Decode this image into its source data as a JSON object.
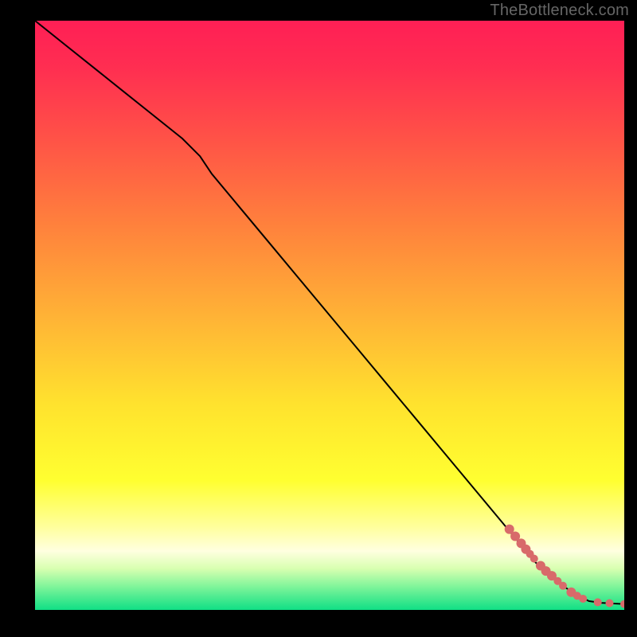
{
  "watermark": "TheBottleneck.com",
  "colors": {
    "background": "#000000",
    "line": "#000000",
    "dot": "#d86a6a",
    "watermark": "#666666"
  },
  "chart_data": {
    "type": "line",
    "title": "",
    "xlabel": "",
    "ylabel": "",
    "xlim": [
      0,
      100
    ],
    "ylim": [
      0,
      100
    ],
    "background_gradient": [
      {
        "offset": 0.0,
        "color": "#ff1f55"
      },
      {
        "offset": 0.08,
        "color": "#ff2e51"
      },
      {
        "offset": 0.2,
        "color": "#ff5247"
      },
      {
        "offset": 0.35,
        "color": "#ff823c"
      },
      {
        "offset": 0.5,
        "color": "#ffb236"
      },
      {
        "offset": 0.65,
        "color": "#ffe22e"
      },
      {
        "offset": 0.78,
        "color": "#ffff30"
      },
      {
        "offset": 0.86,
        "color": "#ffff9e"
      },
      {
        "offset": 0.9,
        "color": "#ffffe0"
      },
      {
        "offset": 0.93,
        "color": "#d8ffb0"
      },
      {
        "offset": 0.96,
        "color": "#80f59a"
      },
      {
        "offset": 1.0,
        "color": "#10df85"
      }
    ],
    "series": [
      {
        "name": "curve",
        "x": [
          0,
          5,
          10,
          15,
          20,
          25,
          28,
          30,
          35,
          40,
          45,
          50,
          55,
          60,
          65,
          70,
          75,
          80,
          85,
          88,
          90,
          92,
          94,
          96,
          98,
          100
        ],
        "y": [
          100,
          96,
          92,
          88,
          84,
          80,
          77,
          74,
          68,
          62,
          56,
          50,
          44,
          38,
          32,
          26,
          20,
          14,
          8,
          5.5,
          3.8,
          2.5,
          1.5,
          1.2,
          1.1,
          1.0
        ]
      }
    ],
    "dots": {
      "name": "markers",
      "points": [
        {
          "x": 80.5,
          "y": 13.7,
          "r": 6
        },
        {
          "x": 81.5,
          "y": 12.5,
          "r": 6
        },
        {
          "x": 82.5,
          "y": 11.3,
          "r": 6
        },
        {
          "x": 83.3,
          "y": 10.3,
          "r": 6
        },
        {
          "x": 84.0,
          "y": 9.5,
          "r": 5
        },
        {
          "x": 84.7,
          "y": 8.7,
          "r": 5
        },
        {
          "x": 85.8,
          "y": 7.5,
          "r": 6
        },
        {
          "x": 86.7,
          "y": 6.6,
          "r": 6
        },
        {
          "x": 87.7,
          "y": 5.8,
          "r": 6
        },
        {
          "x": 88.7,
          "y": 4.9,
          "r": 5
        },
        {
          "x": 89.6,
          "y": 4.1,
          "r": 5
        },
        {
          "x": 91.0,
          "y": 3.0,
          "r": 6
        },
        {
          "x": 92.0,
          "y": 2.4,
          "r": 5
        },
        {
          "x": 93.0,
          "y": 1.9,
          "r": 5
        },
        {
          "x": 95.5,
          "y": 1.3,
          "r": 5
        },
        {
          "x": 97.5,
          "y": 1.15,
          "r": 5
        },
        {
          "x": 100.0,
          "y": 1.0,
          "r": 5
        }
      ]
    }
  }
}
